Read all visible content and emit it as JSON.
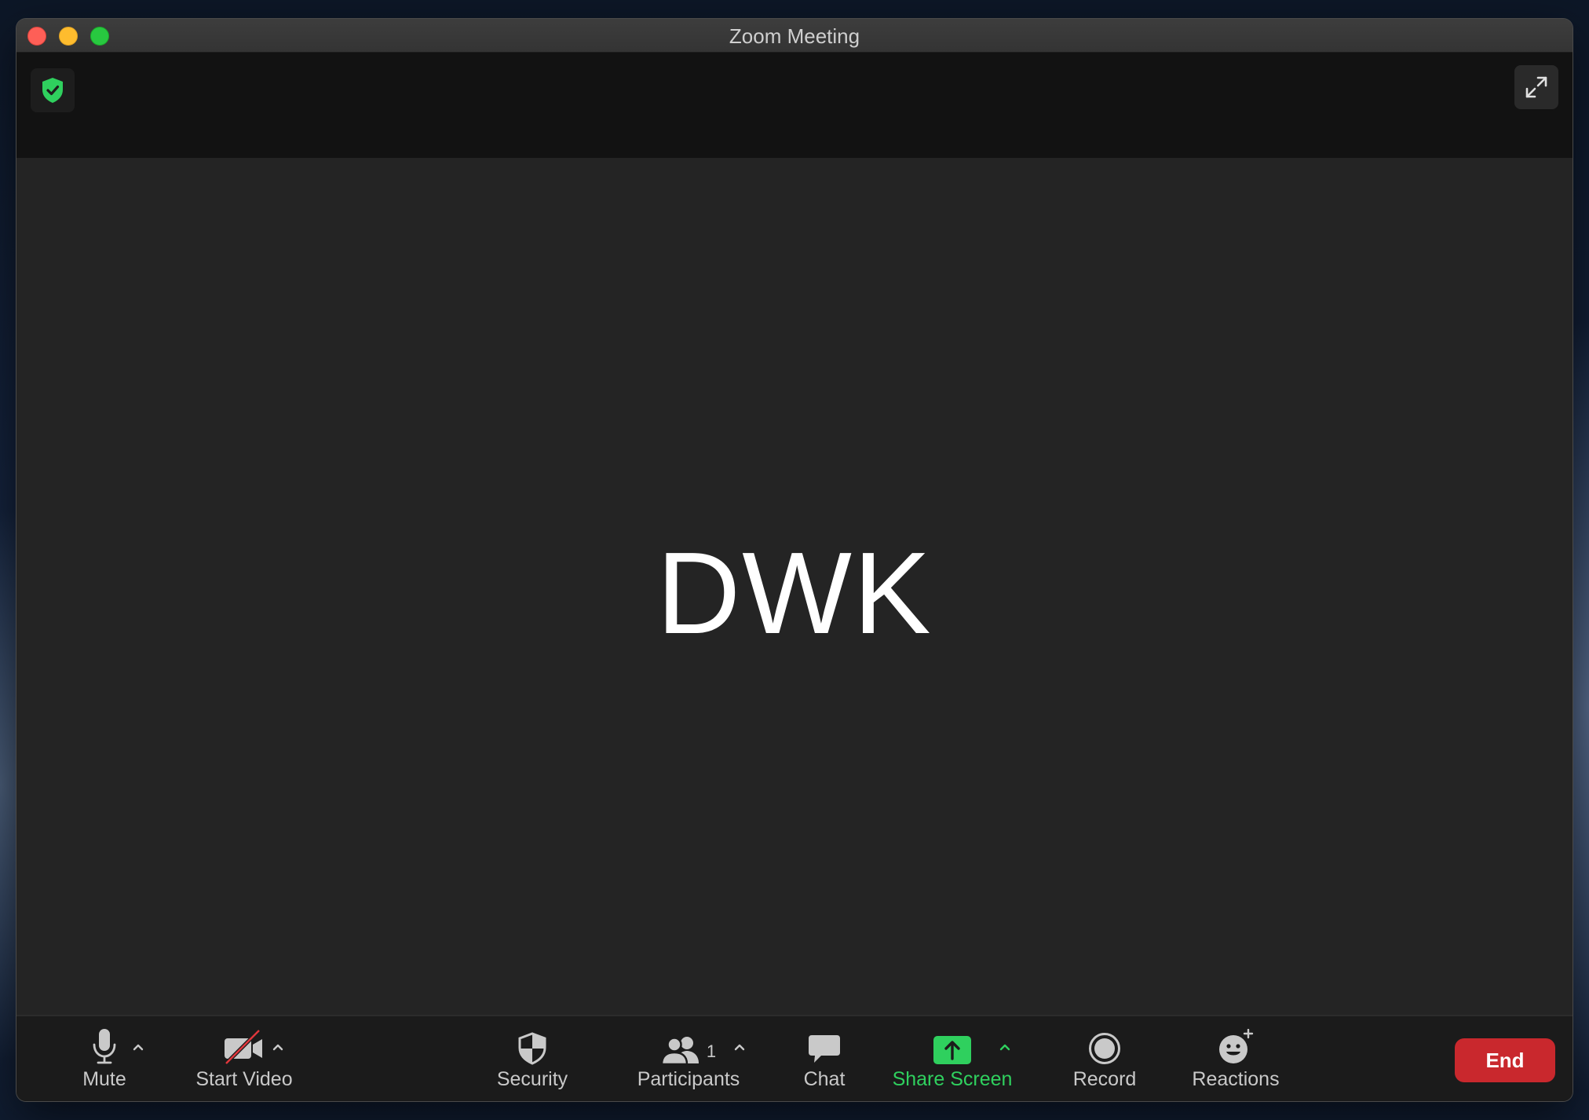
{
  "window": {
    "title": "Zoom Meeting"
  },
  "stage": {
    "participant_initials": "DWK"
  },
  "toolbar": {
    "mute_label": "Mute",
    "start_video_label": "Start Video",
    "security_label": "Security",
    "participants_label": "Participants",
    "participants_count": "1",
    "chat_label": "Chat",
    "share_screen_label": "Share Screen",
    "record_label": "Record",
    "reactions_label": "Reactions",
    "end_label": "End"
  },
  "icons": {
    "encryption": "shield-check-icon",
    "fullscreen": "expand-icon",
    "mute": "microphone-icon",
    "video": "video-off-icon",
    "security": "shield-icon",
    "participants": "people-icon",
    "chat": "chat-bubble-icon",
    "share": "share-screen-icon",
    "record": "record-icon",
    "reactions": "emoji-plus-icon"
  },
  "colors": {
    "accent_green": "#2fd05e",
    "end_red": "#c9282d",
    "stage_bg": "#242424"
  }
}
